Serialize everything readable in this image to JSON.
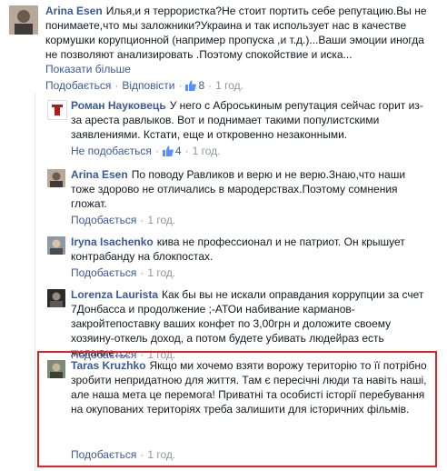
{
  "comments": [
    {
      "name": "Arina Esen",
      "text": "Илья,и я террористка?Не стоит портить себе репутацию.Вы не понимаете,что мы заложники?Украина и так использует нас в качестве кормушки корупционной (например пропуска ,и т.д.)...Ваши эмоции иногда не позволяют анализировать .Поэтому спокойствие и иска...",
      "more_label": "Показати більше",
      "like_label": "Подобається",
      "reply_label": "Відповісти",
      "likes": "8",
      "time": "1 год."
    },
    {
      "name": "Роман Науковець",
      "text": "У него с Аброськиным репутация сейчас горит из-за ареста равлыков. Вот и поднимает такими популистскими заявлениями. Кстати, еще и откровенно незаконными.",
      "like_label": "Не подобається",
      "likes": "4",
      "time": "1 год."
    },
    {
      "name": "Arina Esen",
      "text": "По поводу Равликов и верю и не верю.Знаю,что наши тоже здорово не отличались в мародерствах.Поэтому сомнения гложат.",
      "like_label": "Подобається",
      "time": "1 год."
    },
    {
      "name": "Iryna Isachenko",
      "text": "кива не профессионал и не патриот. Он крышует контрабанду на блокпостах.",
      "like_label": "Подобається",
      "time": "1 год."
    },
    {
      "name": "Lorenza Laurista",
      "text": "Как бы вы не искали оправдания коррупции за счет 7Донбасса и продолжение ;-АТОи набивание карманов-закройтепоставку ваших конфет по 3,00грн и доложите своему хозяину-откель доход, а потом будете убивать людейраз есть желание.....",
      "like_label": "Подобається",
      "time": "1 год."
    },
    {
      "name": "Taras Kruzhko",
      "text": "Якщо ми хочемо взяти ворожу територію то її потрібно зробити непридатною для життя. Там є пересічні люди та навіть наші, але наша мета це перемога! Приватні та особисті історії перебування на окупованих територіях треба залишити для історичних фільмів.",
      "like_label": "Подобається",
      "time": "1 год."
    }
  ],
  "colors": {
    "link": "#3b5998",
    "meta": "#90949c",
    "highlight": "#e02424"
  },
  "icons": {
    "like": "thumb-up-icon"
  }
}
